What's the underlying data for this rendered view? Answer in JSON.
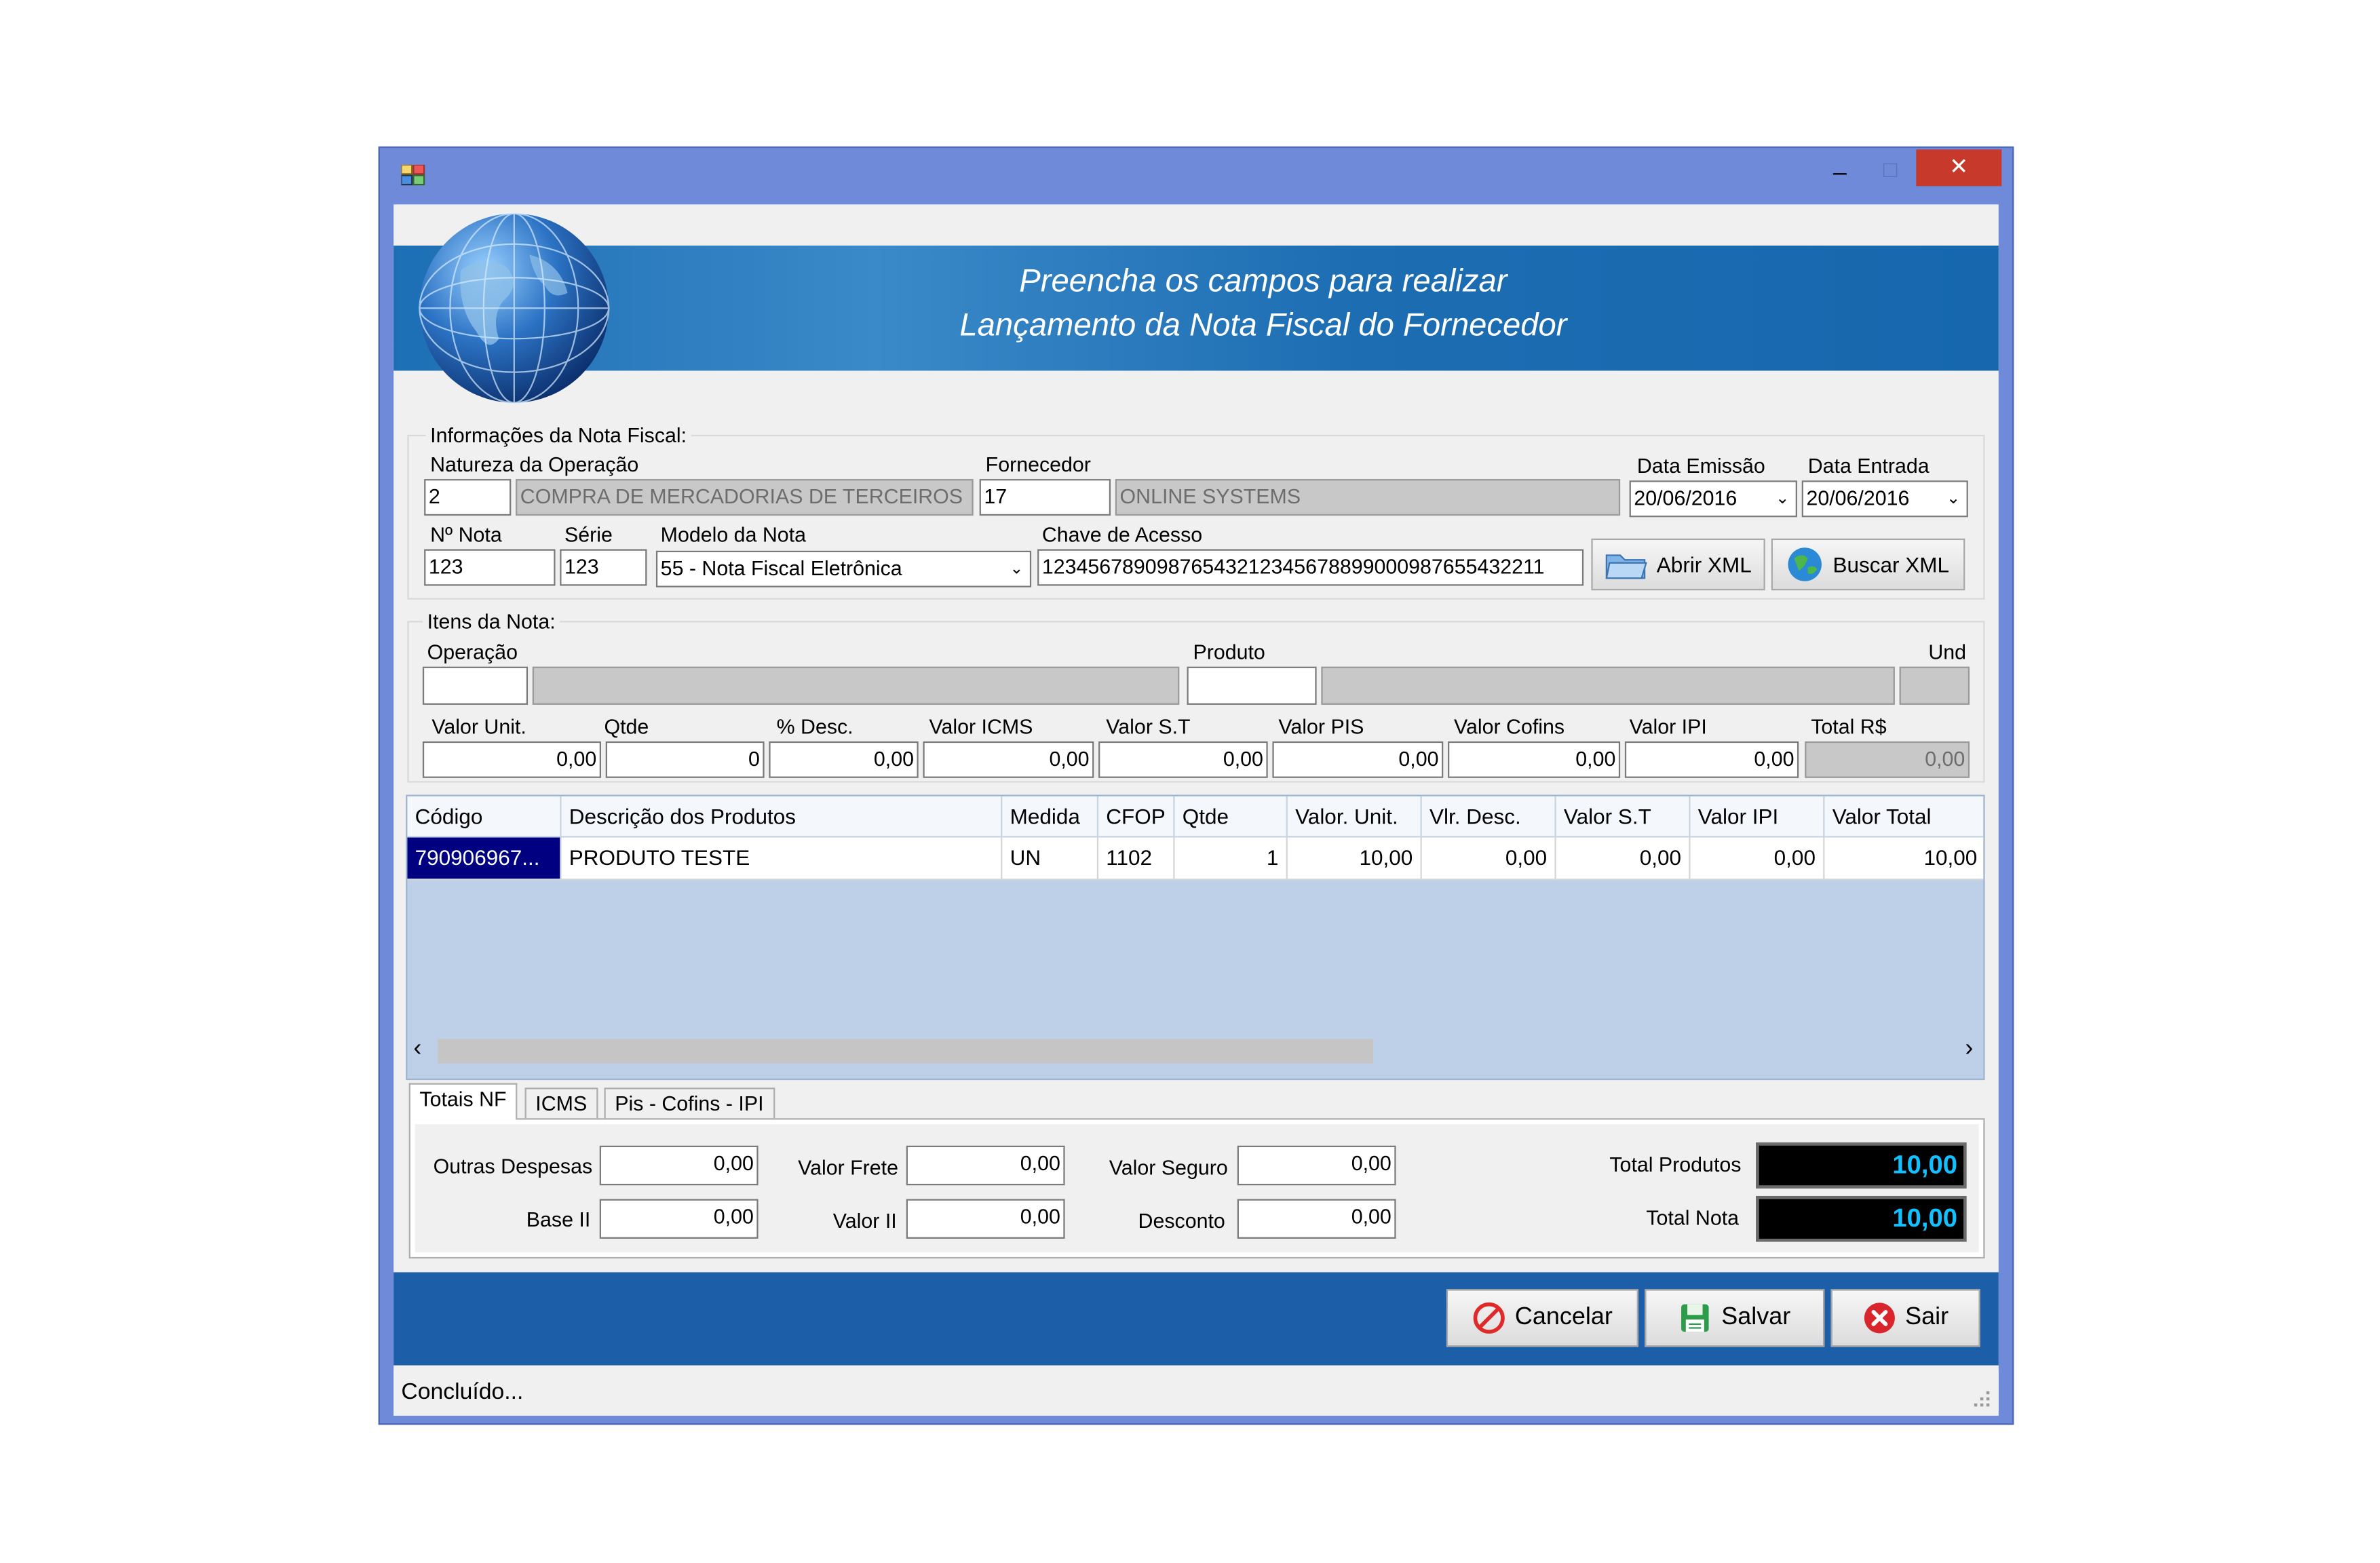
{
  "window": {
    "title_icon": "app-window-icon",
    "controls": {
      "minimize": "–",
      "maximize": "□",
      "close": "✕"
    }
  },
  "banner": {
    "line1": "Preencha os campos para realizar",
    "line2": "Lançamento da Nota Fiscal do Fornecedor",
    "icon": "globe-icon"
  },
  "info": {
    "group_title": "Informações da Nota Fiscal:",
    "natureza_label": "Natureza da Operação",
    "natureza_code": "2",
    "natureza_desc": "COMPRA DE MERCADORIAS DE TERCEIROS",
    "fornecedor_label": "Fornecedor",
    "fornecedor_code": "17",
    "fornecedor_name": "ONLINE SYSTEMS",
    "data_emissao_label": "Data Emissão",
    "data_emissao": "20/06/2016",
    "data_entrada_label": "Data Entrada",
    "data_entrada": "20/06/2016",
    "nota_label": "Nº Nota",
    "nota": "123",
    "serie_label": "Série",
    "serie": "123",
    "modelo_label": "Modelo da Nota",
    "modelo": "55 - Nota Fiscal Eletrônica",
    "chave_label": "Chave de Acesso",
    "chave": "12345678909876543212345678899000987655432211",
    "abrir_xml": "Abrir XML",
    "buscar_xml": "Buscar XML"
  },
  "itens": {
    "group_title": "Itens da Nota:",
    "operacao_label": "Operação",
    "produto_label": "Produto",
    "und_label": "Und",
    "valor_unit_label": "Valor Unit.",
    "valor_unit": "0,00",
    "qtde_label": "Qtde",
    "qtde": "0",
    "desc_label": "% Desc.",
    "desc": "0,00",
    "icms_label": "Valor ICMS",
    "icms": "0,00",
    "st_label": "Valor S.T",
    "st": "0,00",
    "pis_label": "Valor PIS",
    "pis": "0,00",
    "cofins_label": "Valor Cofins",
    "cofins": "0,00",
    "ipi_label": "Valor IPI",
    "ipi": "0,00",
    "total_label": "Total R$",
    "total": "0,00"
  },
  "grid": {
    "columns": [
      "Código",
      "Descrição dos Produtos",
      "Medida",
      "CFOP",
      "Qtde",
      "Valor. Unit.",
      "Vlr. Desc.",
      "Valor S.T",
      "Valor IPI",
      "Valor Total"
    ],
    "rows": [
      [
        "790906967...",
        "PRODUTO TESTE",
        "UN",
        "1102",
        "1",
        "10,00",
        "0,00",
        "0,00",
        "0,00",
        "10,00"
      ]
    ]
  },
  "tabs": [
    "Totais NF",
    "ICMS",
    "Pis - Cofins - IPI"
  ],
  "totais": {
    "outras_label": "Outras Despesas",
    "outras": "0,00",
    "frete_label": "Valor Frete",
    "frete": "0,00",
    "seguro_label": "Valor Seguro",
    "seguro": "0,00",
    "base_label": "Base II",
    "base": "0,00",
    "valor_ii_label": "Valor II",
    "valor_ii": "0,00",
    "desconto_label": "Desconto",
    "desconto": "0,00",
    "total_produtos_label": "Total Produtos",
    "total_produtos": "10,00",
    "total_nota_label": "Total Nota",
    "total_nota": "10,00"
  },
  "actions": {
    "cancelar": "Cancelar",
    "salvar": "Salvar",
    "sair": "Sair"
  },
  "status": "Concluído..."
}
